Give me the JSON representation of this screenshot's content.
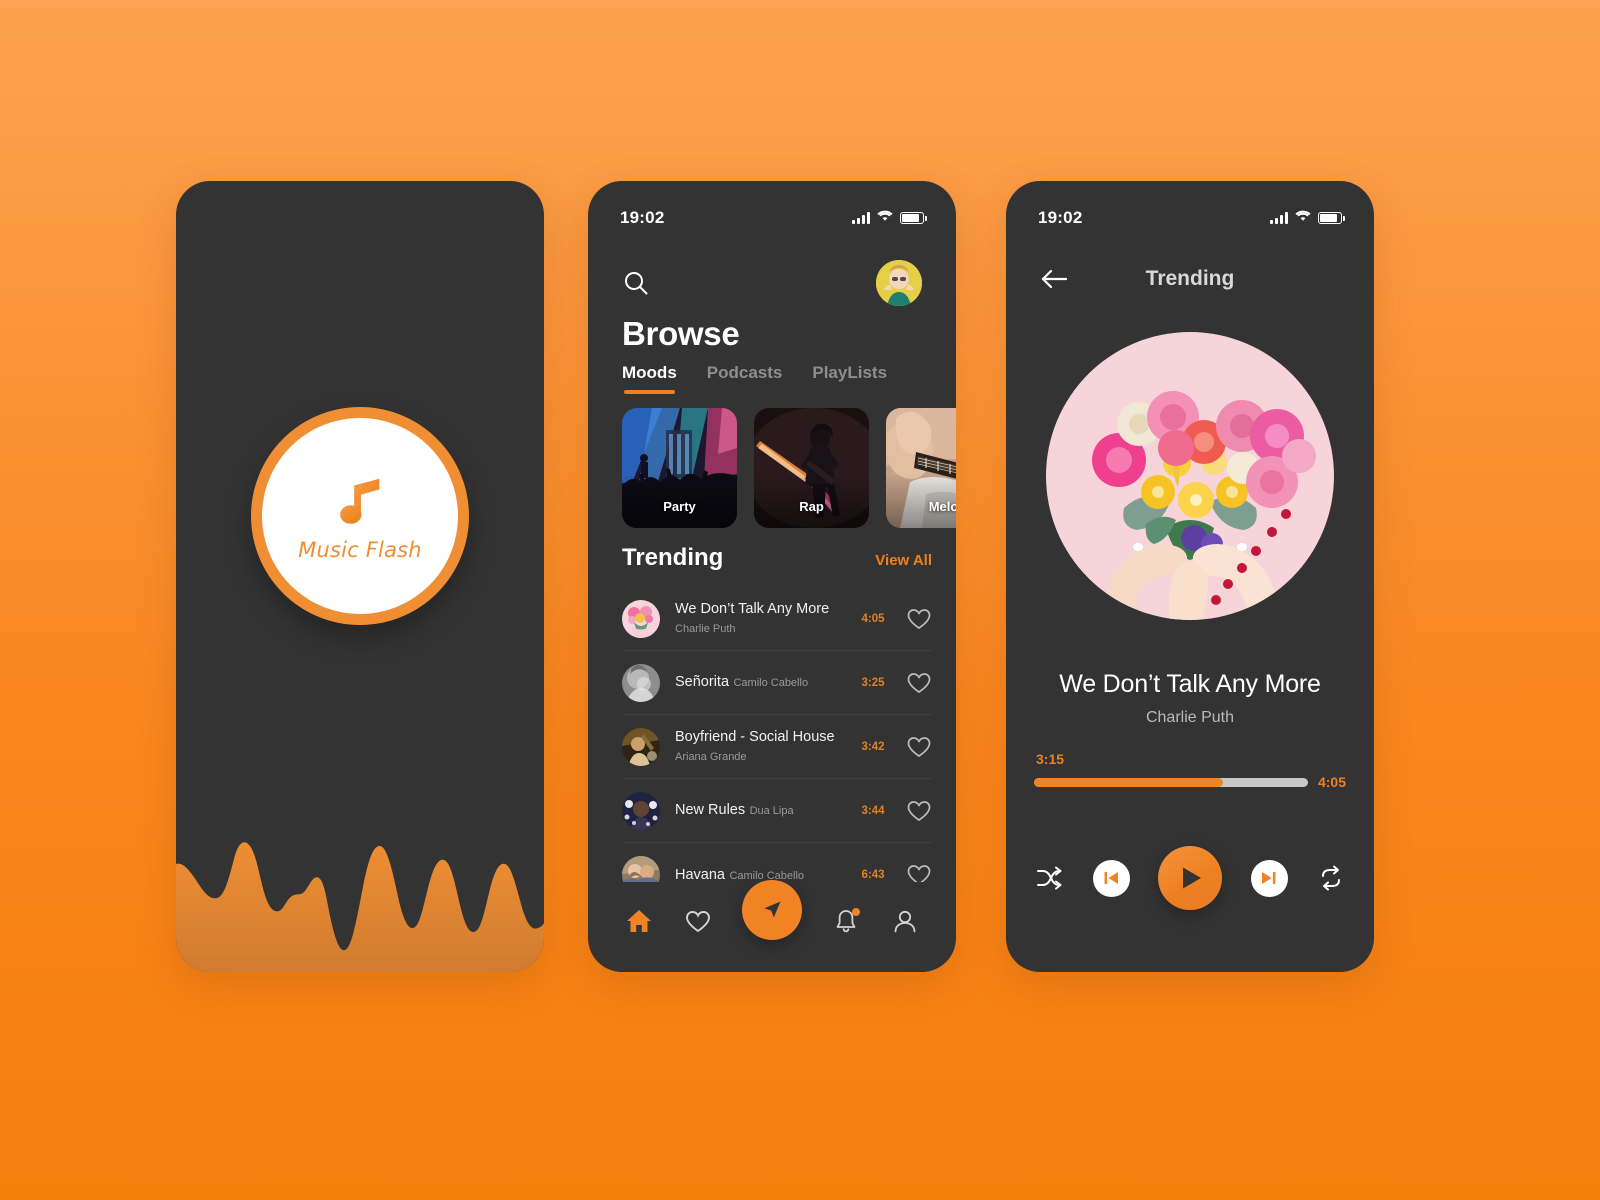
{
  "theme": {
    "accent": "#ee8022",
    "accent_light": "#f4943d",
    "screen_bg": "#333333",
    "page_bg_top": "#fca250",
    "page_bg_bottom": "#f67f0c",
    "text_primary": "#ffffff",
    "text_muted": "#9b9b9b"
  },
  "splash": {
    "app_name": "Music Flash",
    "logo_icon": "music-note-icon"
  },
  "browse": {
    "status": {
      "time": "19:02",
      "signal_icon": "signal-bars-icon",
      "wifi_icon": "wifi-icon",
      "battery_icon": "battery-icon"
    },
    "search_icon": "search-icon",
    "avatar_icon": "user-avatar",
    "title": "Browse",
    "tabs": [
      {
        "label": "Moods",
        "active": true
      },
      {
        "label": "Podcasts",
        "active": false
      },
      {
        "label": "PlayLists",
        "active": false
      }
    ],
    "moods": [
      {
        "label": "Party",
        "art": "concert-crowd"
      },
      {
        "label": "Rap",
        "art": "guitarist-stage"
      },
      {
        "label": "Melo",
        "art": "acoustic-guitar"
      }
    ],
    "trending": {
      "heading": "Trending",
      "view_all": "View All",
      "tracks": [
        {
          "title": "We Don’t Talk Any More",
          "artist": "Charlie Puth",
          "duration": "4:05",
          "art": "flower-heart",
          "liked": false
        },
        {
          "title": "Señorita",
          "artist": "Camilo Cabello",
          "duration": "3:25",
          "art": "grey-portrait",
          "liked": false
        },
        {
          "title": "Boyfriend - Social House",
          "artist": "Ariana Grande",
          "duration": "3:42",
          "art": "warm-portrait",
          "liked": false
        },
        {
          "title": "New Rules",
          "artist": "Dua Lipa",
          "duration": "3:44",
          "art": "navy-portrait",
          "liked": false
        },
        {
          "title": "Havana",
          "artist": "Camilo Cabello",
          "duration": "6:43",
          "art": "couple-portrait",
          "liked": false
        }
      ]
    },
    "nav": [
      {
        "name": "home",
        "icon": "home-icon",
        "active": true
      },
      {
        "name": "favorites",
        "icon": "heart-icon",
        "active": false
      },
      {
        "name": "explore",
        "icon": "navigate-icon",
        "active": false
      },
      {
        "name": "notifications",
        "icon": "bell-icon",
        "active": false,
        "badge": true
      },
      {
        "name": "profile",
        "icon": "person-icon",
        "active": false
      }
    ]
  },
  "player": {
    "status": {
      "time": "19:02",
      "signal_icon": "signal-bars-icon",
      "wifi_icon": "wifi-icon",
      "battery_icon": "battery-icon"
    },
    "back_icon": "arrow-left-icon",
    "header_title": "Trending",
    "album_art": "flower-heart",
    "song_title": "We Don’t Talk Any More",
    "song_artist": "Charlie Puth",
    "time_current": "3:15",
    "time_total": "4:05",
    "progress_percent": 69,
    "controls": {
      "shuffle": "shuffle-icon",
      "previous": "skip-previous-icon",
      "play": "play-icon",
      "next": "skip-next-icon",
      "repeat": "repeat-icon"
    }
  }
}
